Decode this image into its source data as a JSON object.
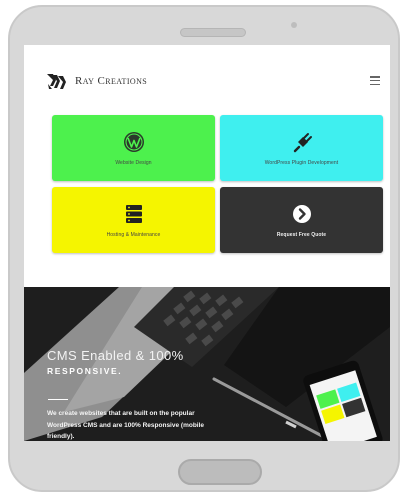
{
  "site": {
    "logo_text": "Ray Creations"
  },
  "services": [
    {
      "label": "Website Design",
      "icon": "wordpress-icon",
      "color": "#4df14d"
    },
    {
      "label": "WordPress Plugin Development",
      "icon": "plug-icon",
      "color": "#3fefef"
    },
    {
      "label": "Hosting & Maintenance",
      "icon": "server-icon",
      "color": "#f5f500"
    },
    {
      "label": "Request Free Quote",
      "icon": "arrow-circle-icon",
      "color": "#333333"
    }
  ],
  "hero": {
    "title": "CMS Enabled & 100%",
    "subtitle": "RESPONSIVE.",
    "body": "We create websites that are built on the popular WordPress CMS and are 100% Responsive (mobile friendly)."
  },
  "colors": {
    "device_body": "#d8d8d8",
    "hero_background": "#1e1e1e"
  }
}
